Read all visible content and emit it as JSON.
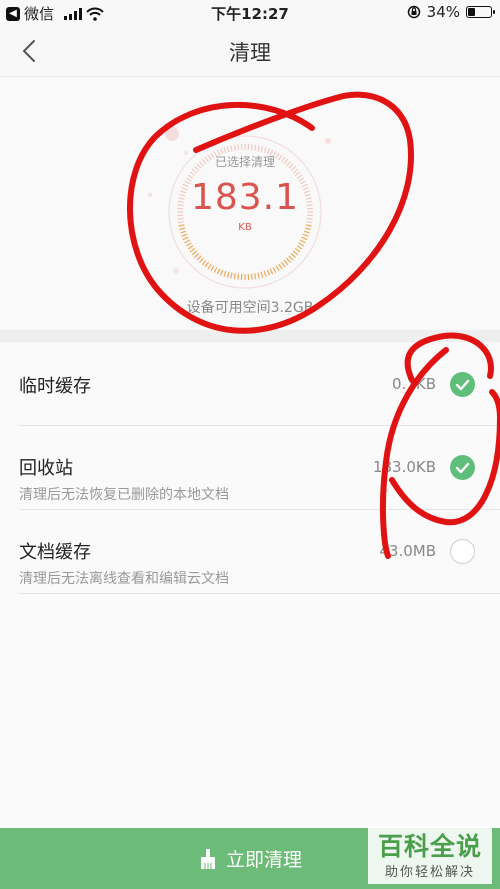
{
  "status_bar": {
    "carrier": "微信",
    "time": "下午12:27",
    "battery_percent": "34%",
    "battery_level": 0.34,
    "back_icon": "back-arrow-icon",
    "signal_icon": "signal-icon",
    "wifi_icon": "wifi-icon",
    "lock_icon": "orientation-lock-icon"
  },
  "nav": {
    "title": "清理",
    "back_icon": "chevron-left-icon"
  },
  "summary": {
    "label": "已选择清理",
    "value": "183.1",
    "unit": "KB",
    "available_space": "设备可用空间3.2GB",
    "accent_color": "#d9534f",
    "ring_color": "#f0a85a"
  },
  "items": [
    {
      "name": "临时缓存",
      "description": "",
      "size": "0.1KB",
      "checked": true
    },
    {
      "name": "回收站",
      "description": "清理后无法恢复已删除的本地文档",
      "size": "183.0KB",
      "checked": true
    },
    {
      "name": "文档缓存",
      "description": "清理后无法离线查看和编辑云文档",
      "size": "43.0MB",
      "checked": false
    }
  ],
  "clean_button": {
    "label": "立即清理",
    "icon": "broom-icon",
    "color": "#6dbb78"
  },
  "watermark": {
    "title": "百科全说",
    "subtitle": "助你轻松解决"
  },
  "check_color": "#5fbf7a"
}
